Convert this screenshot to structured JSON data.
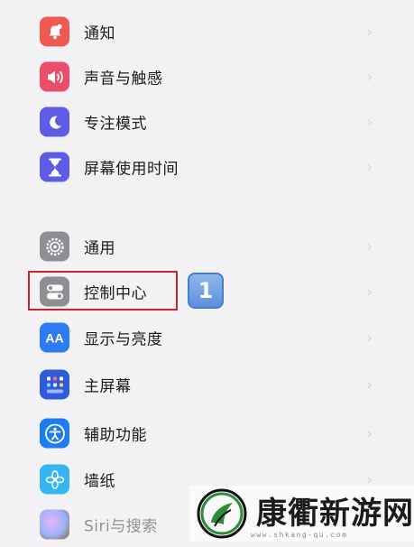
{
  "settings_rows": [
    {
      "label": "通知",
      "icon": "bell-badge-icon",
      "color": "#ee5a52"
    },
    {
      "label": "声音与触感",
      "icon": "speaker-icon",
      "color": "#ea4e6a"
    },
    {
      "label": "专注模式",
      "icon": "moon-icon",
      "color": "#5e5ce6"
    },
    {
      "label": "屏幕使用时间",
      "icon": "hourglass-icon",
      "color": "#5e5ce6"
    },
    {
      "label": "通用",
      "icon": "gear-icon",
      "color": "#8e8e93"
    },
    {
      "label": "控制中心",
      "icon": "toggles-icon",
      "color": "#8e8e93"
    },
    {
      "label": "显示与亮度",
      "icon": "text-size-icon",
      "color": "#2f7bf6"
    },
    {
      "label": "主屏幕",
      "icon": "home-grid-icon",
      "color": "#2f5bd8"
    },
    {
      "label": "辅助功能",
      "icon": "accessibility-icon",
      "color": "#1c7cf0"
    },
    {
      "label": "墙纸",
      "icon": "flower-icon",
      "color": "#36b6f0"
    },
    {
      "label": "Siri与搜索",
      "icon": "siri-icon",
      "color": "#222222"
    }
  ],
  "annotation": {
    "step_number": "1",
    "highlight_color": "#c8262b"
  },
  "watermark": {
    "brand": "康衢新游网",
    "url": "www.shkang-qu.com"
  }
}
